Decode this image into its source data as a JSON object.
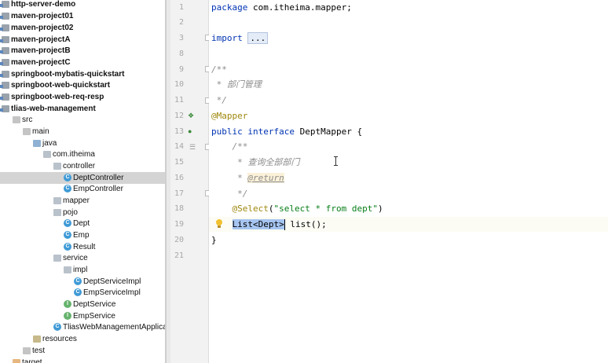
{
  "tree": [
    {
      "label": "http-server-demo",
      "kind": "module"
    },
    {
      "label": "maven-project01",
      "kind": "module"
    },
    {
      "label": "maven-project02",
      "kind": "module"
    },
    {
      "label": "maven-projectA",
      "kind": "module"
    },
    {
      "label": "maven-projectB",
      "kind": "module"
    },
    {
      "label": "maven-projectC",
      "kind": "module"
    },
    {
      "label": "springboot-mybatis-quickstart",
      "kind": "module"
    },
    {
      "label": "springboot-web-quickstart",
      "kind": "module"
    },
    {
      "label": "springboot-web-req-resp",
      "kind": "module"
    },
    {
      "label": "tlias-web-management",
      "kind": "module"
    },
    {
      "label": "src",
      "kind": "folder"
    },
    {
      "label": "main",
      "kind": "folder"
    },
    {
      "label": "java",
      "kind": "src-folder"
    },
    {
      "label": "com.itheima",
      "kind": "package"
    },
    {
      "label": "controller",
      "kind": "package"
    },
    {
      "label": "DeptController",
      "kind": "class",
      "selected": true
    },
    {
      "label": "EmpController",
      "kind": "class"
    },
    {
      "label": "mapper",
      "kind": "package"
    },
    {
      "label": "pojo",
      "kind": "package"
    },
    {
      "label": "Dept",
      "kind": "class"
    },
    {
      "label": "Emp",
      "kind": "class"
    },
    {
      "label": "Result",
      "kind": "class"
    },
    {
      "label": "service",
      "kind": "package"
    },
    {
      "label": "impl",
      "kind": "package"
    },
    {
      "label": "DeptServiceImpl",
      "kind": "class"
    },
    {
      "label": "EmpServiceImpl",
      "kind": "class"
    },
    {
      "label": "DeptService",
      "kind": "interface"
    },
    {
      "label": "EmpService",
      "kind": "interface"
    },
    {
      "label": "TliasWebManagementApplication",
      "kind": "class"
    },
    {
      "label": "resources",
      "kind": "resources"
    },
    {
      "label": "test",
      "kind": "folder"
    },
    {
      "label": "target",
      "kind": "excluded"
    }
  ],
  "editor": {
    "line_numbers": [
      "1",
      "2",
      "3",
      "8",
      "9",
      "10",
      "11",
      "12",
      "13",
      "14",
      "15",
      "16",
      "17",
      "18",
      "19",
      "20",
      "21"
    ],
    "code": {
      "l1_kw": "package",
      "l1_rest": " com.itheima.mapper;",
      "l3_kw": "import",
      "l3_fold": "...",
      "l9": "/**",
      "l10": " * 部门管理",
      "l11": " */",
      "l12": "@Mapper",
      "l13_kw1": "public",
      "l13_kw2": "interface",
      "l13_rest": " DeptMapper {",
      "l14": "    /**",
      "l15": "     * 查询全部部门",
      "l16_pre": "     * ",
      "l16_tag": "@return",
      "l17": "     */",
      "l18_ann": "@Select",
      "l18_open": "(",
      "l18_str": "\"select * from dept\"",
      "l18_close": ")",
      "l19_sel": "List<Dept>",
      "l19_rest": " list();",
      "l20": "}"
    }
  },
  "colors": {
    "keyword": "#0033b3",
    "annotation": "#9e880d",
    "string": "#067d17",
    "comment": "#8c8c8c",
    "selection": "#a6c5f0"
  }
}
